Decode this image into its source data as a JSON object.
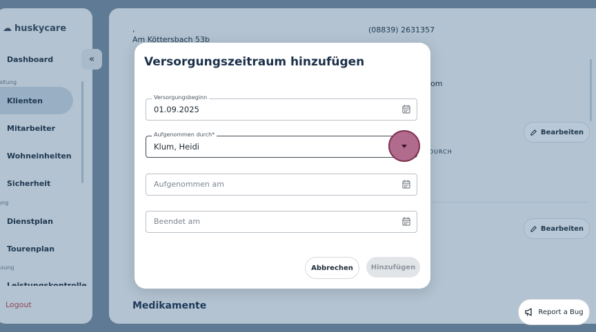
{
  "app": {
    "logo": "huskycare"
  },
  "sidebar": {
    "collapse_icon": "«",
    "items": [
      {
        "label": "Dashboard"
      },
      {
        "label": "Klienten"
      },
      {
        "label": "Mitarbeiter"
      },
      {
        "label": "Wohneinheiten"
      },
      {
        "label": "Sicherheit"
      },
      {
        "label": "Dienstplan"
      },
      {
        "label": "Tourenplan"
      },
      {
        "label": "Leistungskontrolle"
      }
    ],
    "sections": [
      "waltung",
      "nung",
      "assung"
    ],
    "logout": "Logout"
  },
  "background": {
    "comma": ",",
    "street": "Am Köttersbach 53b",
    "phone": "(08839) 2631357",
    "email_fragment": "om",
    "durch_fragment": "DURCH",
    "edit_label": "Bearbeiten",
    "medikamente": "Medikamente"
  },
  "modal": {
    "title": "Versorgungszeitraum hinzufügen",
    "start": {
      "legend": "Versorgungsbeginn",
      "value": "01.09.2025"
    },
    "admitted_by": {
      "legend": "Aufgenommen durch*",
      "value": "Klum, Heidi"
    },
    "admitted_on": {
      "placeholder": "Aufgenommen am"
    },
    "ended_on": {
      "placeholder": "Beendet am"
    },
    "cancel": "Abbrechen",
    "add": "Hinzufügen"
  },
  "report_bug": "Report a Bug"
}
